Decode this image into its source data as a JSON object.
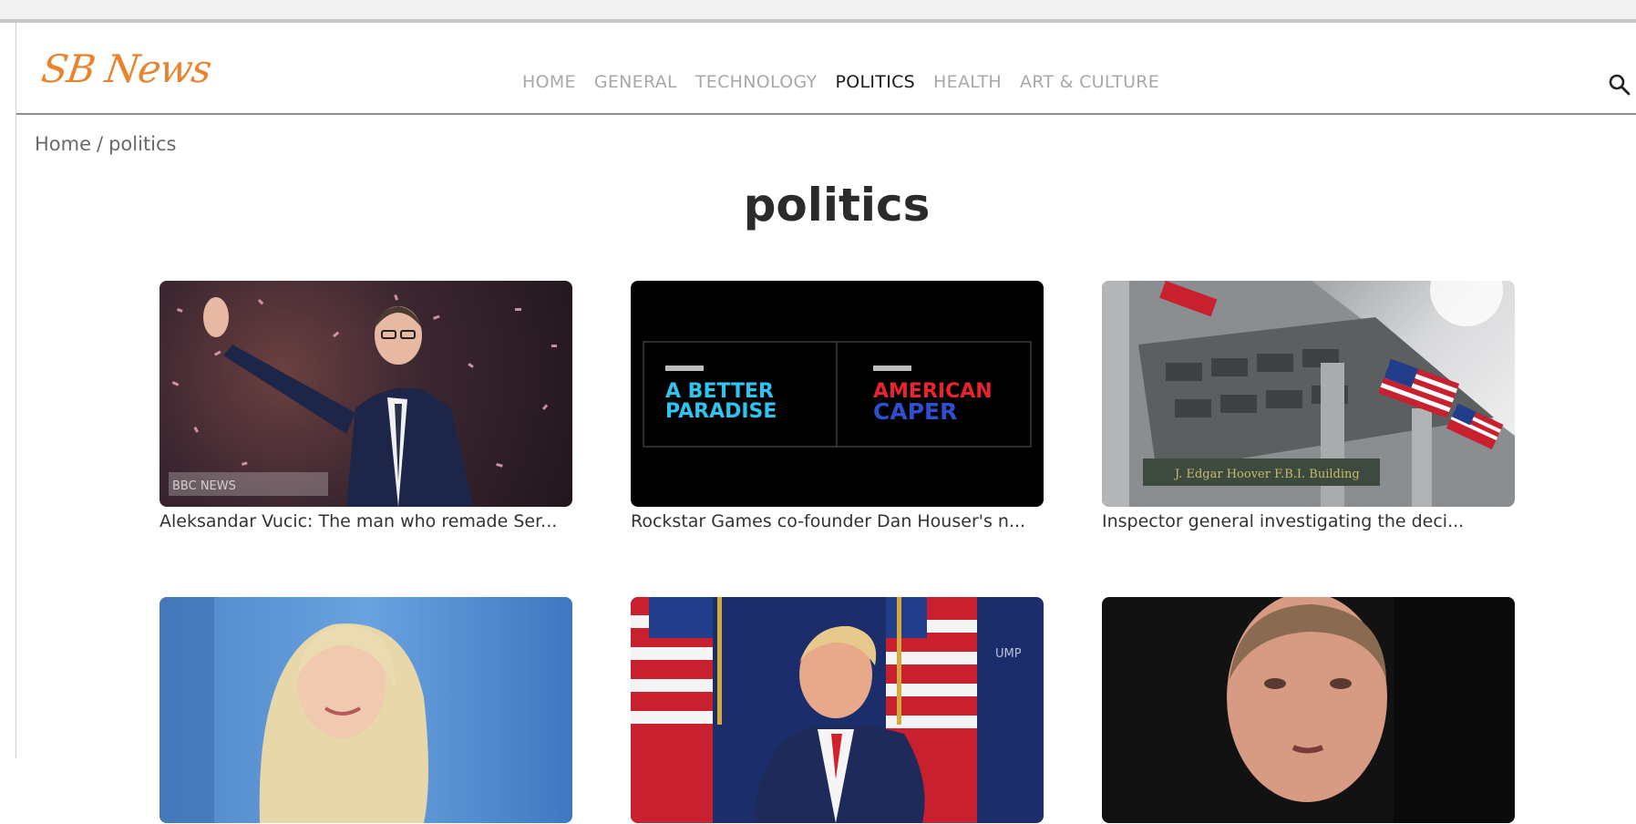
{
  "site": {
    "logo": "SB News"
  },
  "nav": {
    "items": [
      {
        "label": "HOME",
        "active": false
      },
      {
        "label": "GENERAL",
        "active": false
      },
      {
        "label": "TECHNOLOGY",
        "active": false
      },
      {
        "label": "POLITICS",
        "active": true
      },
      {
        "label": "HEALTH",
        "active": false
      },
      {
        "label": "ART & CULTURE",
        "active": false
      }
    ],
    "search_icon": "search-icon"
  },
  "breadcrumb": {
    "home": "Home",
    "separator": "/",
    "current": "politics"
  },
  "page": {
    "title": "politics"
  },
  "articles": [
    {
      "caption": "Aleksandar Vucic: The man who remade Ser...",
      "watermark": "BBC NEWS"
    },
    {
      "caption": "Rockstar Games co-founder Dan Houser's n...",
      "left_title_1": "A BETTER",
      "left_title_2": "PARADISE",
      "right_title_1": "AMERICAN",
      "right_title_2": "CAPER"
    },
    {
      "caption": "Inspector general investigating the deci...",
      "building_sign": "J. Edgar Hoover F.B.I. Building"
    },
    {
      "caption": ""
    },
    {
      "caption": "",
      "banner_text": "UMP"
    },
    {
      "caption": ""
    }
  ],
  "colors": {
    "brand": "#e8842c",
    "nav_active": "#1a1a1a",
    "nav_inactive": "#a8a8a8"
  }
}
